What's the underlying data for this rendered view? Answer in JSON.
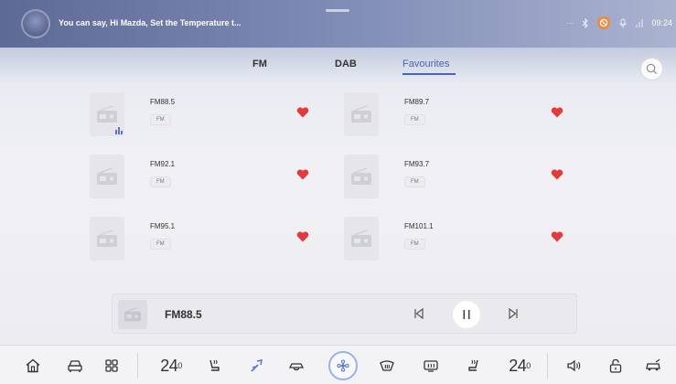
{
  "status_bar": {
    "voice_hint": "You can say, Hi Mazda, Set the Temperature t...",
    "more_label": "···",
    "clock": "09:24",
    "icons": [
      "more-icon",
      "bluetooth-icon",
      "no-signal-icon",
      "voice-icon",
      "signal-icon"
    ]
  },
  "tabs": [
    {
      "label": "FM",
      "active": false
    },
    {
      "label": "DAB",
      "active": false
    },
    {
      "label": "Favourites",
      "active": true
    }
  ],
  "accent_color": "#4a64b8",
  "heart_color": "#e23b3b",
  "stations": [
    {
      "name": "FM88.5",
      "band": "FM",
      "favourite": true,
      "playing": true
    },
    {
      "name": "FM89.7",
      "band": "FM",
      "favourite": true,
      "playing": false
    },
    {
      "name": "FM92.1",
      "band": "FM",
      "favourite": true,
      "playing": false
    },
    {
      "name": "FM93.7",
      "band": "FM",
      "favourite": true,
      "playing": false
    },
    {
      "name": "FM95.1",
      "band": "FM",
      "favourite": true,
      "playing": false
    },
    {
      "name": "FM101.1",
      "band": "FM",
      "favourite": true,
      "playing": false
    }
  ],
  "player": {
    "now_playing": "FM88.5",
    "state": "playing"
  },
  "dock": {
    "left_temp": "24",
    "left_temp_decimal": "0",
    "right_temp": "24",
    "right_temp_decimal": "0",
    "icons": [
      "home-icon",
      "car-icon",
      "apps-grid-icon",
      "seat-heat-icon",
      "airflow-icon",
      "recirculation-icon",
      "fan-icon",
      "front-defrost-icon",
      "rear-defrost-icon",
      "seat-heat-right-icon",
      "volume-icon",
      "lock-icon",
      "car-settings-icon"
    ]
  }
}
